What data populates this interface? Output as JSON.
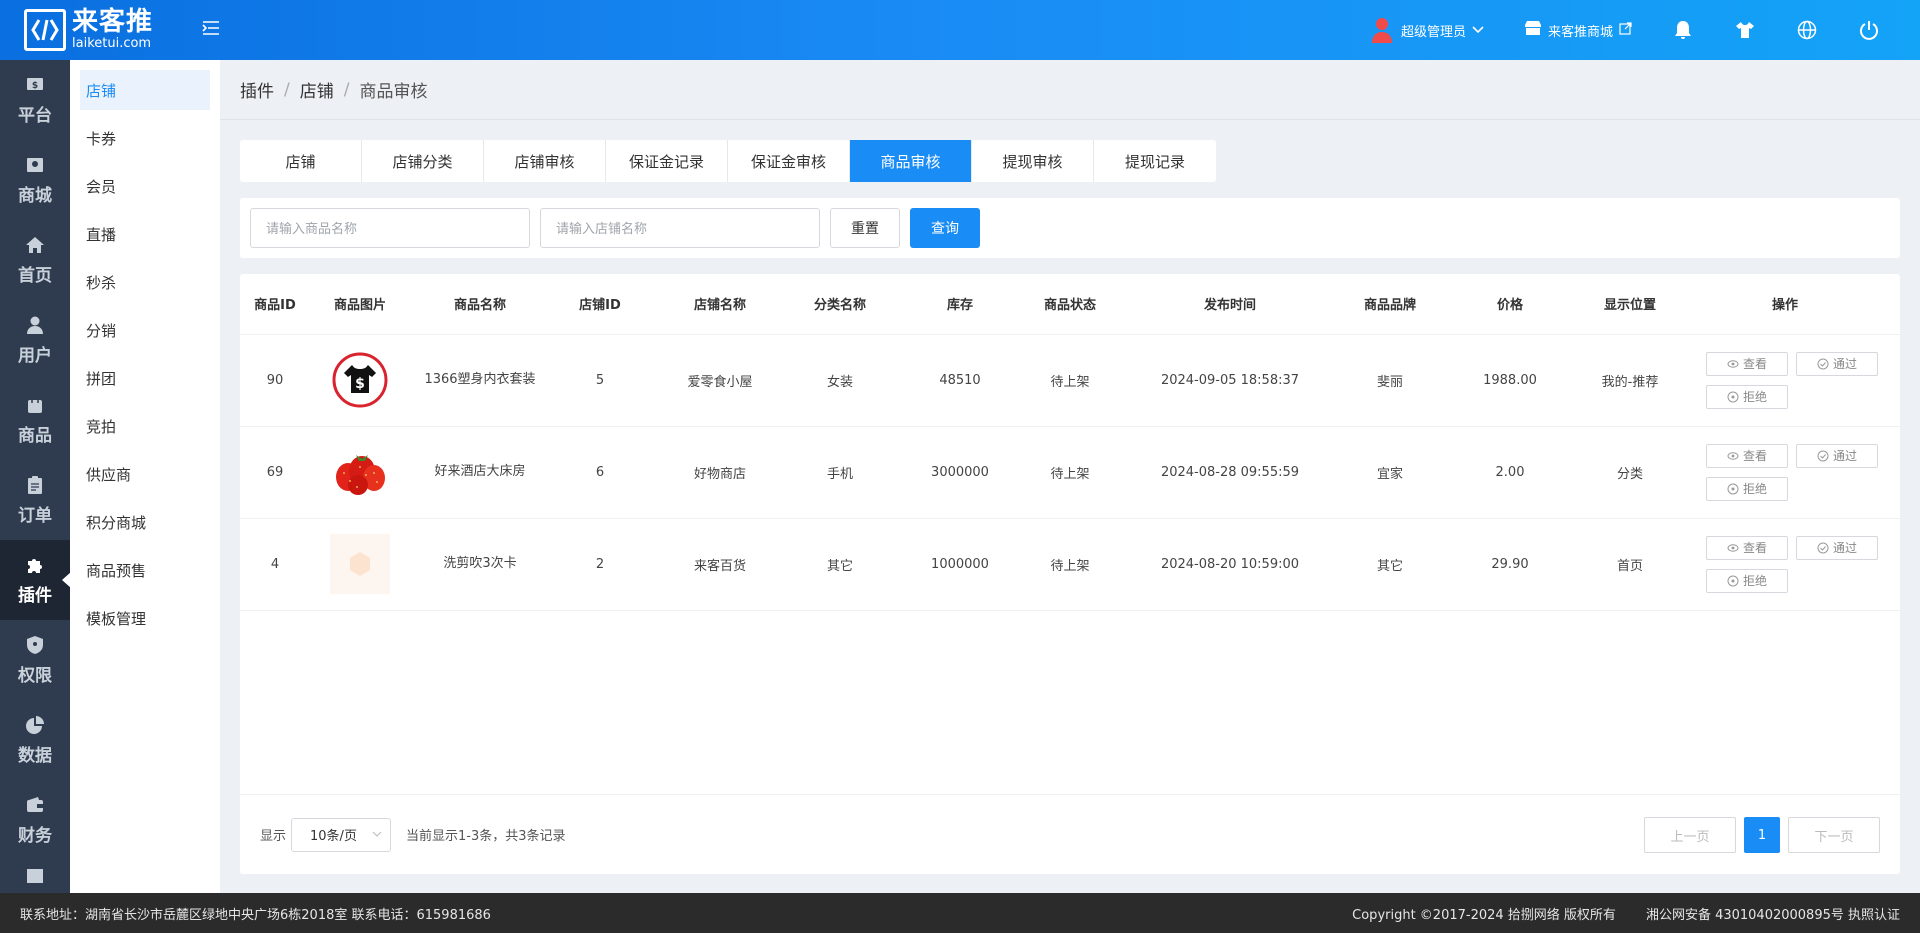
{
  "header": {
    "logo_cn": "来客推",
    "logo_en": "laiketui.com",
    "user_label": "超级管理员",
    "store_label": "来客推商城"
  },
  "leftnav": [
    {
      "label": "平台",
      "icon": "dollar-icon"
    },
    {
      "label": "商城",
      "icon": "store-icon"
    },
    {
      "label": "首页",
      "icon": "home-icon"
    },
    {
      "label": "用户",
      "icon": "user-icon"
    },
    {
      "label": "商品",
      "icon": "bag-icon"
    },
    {
      "label": "订单",
      "icon": "clipboard-icon"
    },
    {
      "label": "插件",
      "icon": "puzzle-icon",
      "active": true
    },
    {
      "label": "权限",
      "icon": "shield-icon"
    },
    {
      "label": "数据",
      "icon": "pie-icon"
    },
    {
      "label": "财务",
      "icon": "wallet-icon"
    }
  ],
  "subnav": [
    "店铺",
    "卡券",
    "会员",
    "直播",
    "秒杀",
    "分销",
    "拼团",
    "竞拍",
    "供应商",
    "积分商城",
    "商品预售",
    "模板管理"
  ],
  "breadcrumb": {
    "a": "插件",
    "b": "店铺",
    "c": "商品审核"
  },
  "tabs": [
    "店铺",
    "店铺分类",
    "店铺审核",
    "保证金记录",
    "保证金审核",
    "商品审核",
    "提现审核",
    "提现记录"
  ],
  "filter": {
    "product_placeholder": "请输入商品名称",
    "store_placeholder": "请输入店铺名称",
    "reset": "重置",
    "search": "查询"
  },
  "table": {
    "columns": [
      "商品ID",
      "商品图片",
      "商品名称",
      "店铺ID",
      "店铺名称",
      "分类名称",
      "库存",
      "商品状态",
      "发布时间",
      "商品品牌",
      "价格",
      "显示位置",
      "操作"
    ],
    "rows": [
      {
        "id": "90",
        "name": "1366塑身内衣套装",
        "store_id": "5",
        "store_name": "爱零食小屋",
        "category": "女装",
        "stock": "48510",
        "status": "待上架",
        "time": "2024-09-05 18:58:37",
        "brand": "斐丽",
        "price": "1988.00",
        "position": "我的-推荐"
      },
      {
        "id": "69",
        "name": "好来酒店大床房",
        "store_id": "6",
        "store_name": "好物商店",
        "category": "手机",
        "stock": "3000000",
        "status": "待上架",
        "time": "2024-08-28 09:55:59",
        "brand": "宜家",
        "price": "2.00",
        "position": "分类"
      },
      {
        "id": "4",
        "name": "洗剪吹3次卡",
        "store_id": "2",
        "store_name": "来客百货",
        "category": "其它",
        "stock": "1000000",
        "status": "待上架",
        "time": "2024-08-20 10:59:00",
        "brand": "其它",
        "price": "29.90",
        "position": "首页"
      }
    ],
    "op_view": "查看",
    "op_pass": "通过",
    "op_reject": "拒绝"
  },
  "pager": {
    "show_label": "显示",
    "page_size": "10条/页",
    "summary": "当前显示1-3条，共3条记录",
    "prev": "上一页",
    "current": "1",
    "next": "下一页"
  },
  "footer": {
    "address": "联系地址：湖南省长沙市岳麓区绿地中央广场6栋2018室 联系电话：615981686",
    "copyright": "Copyright ©2017-2024 拾捌网络 版权所有",
    "icp": "湘公网安备 43010402000895号 执照认证"
  },
  "colors": {
    "primary": "#1a8cf5",
    "nav_bg": "#2f3b4e",
    "footer_bg": "#2b2b2b"
  }
}
